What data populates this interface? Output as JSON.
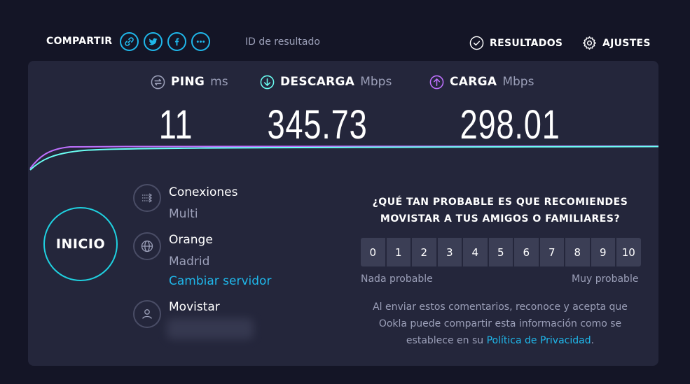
{
  "header": {
    "share_label": "COMPARTIR",
    "share_icons": [
      "link-icon",
      "twitter-icon",
      "facebook-icon",
      "more-icon"
    ],
    "result_id_label": "ID de resultado",
    "results_label": "RESULTADOS",
    "settings_label": "AJUSTES"
  },
  "metrics": {
    "ping": {
      "name": "PING",
      "unit": "ms",
      "value": "11",
      "color": "#9b9fb8"
    },
    "download": {
      "name": "DESCARGA",
      "unit": "Mbps",
      "value": "345.73",
      "color": "#6afff3"
    },
    "upload": {
      "name": "CARGA",
      "unit": "Mbps",
      "value": "298.01",
      "color": "#bf71ff"
    }
  },
  "start_button": {
    "label": "INICIO"
  },
  "info": {
    "connections": {
      "title": "Conexiones",
      "value": "Multi"
    },
    "server": {
      "title": "Orange",
      "location": "Madrid",
      "change_label": "Cambiar servidor"
    },
    "isp": {
      "title": "Movistar"
    }
  },
  "survey": {
    "question": "¿QUÉ TAN PROBABLE ES QUE RECOMIENDES MOVISTAR A TUS AMIGOS O FAMILIARES?",
    "scale": [
      "0",
      "1",
      "2",
      "3",
      "4",
      "5",
      "6",
      "7",
      "8",
      "9",
      "10"
    ],
    "low_label": "Nada probable",
    "high_label": "Muy probable",
    "disclaimer_text": "Al enviar estos comentarios, reconoce y acepta que Ookla puede compartir esta información como se establece en su ",
    "privacy_link": "Política de Privacidad",
    "disclaimer_end": "."
  },
  "colors": {
    "accent": "#1fb7ea",
    "download": "#6afff3",
    "upload": "#bf71ff",
    "panel": "#24263b",
    "background": "#141526"
  }
}
